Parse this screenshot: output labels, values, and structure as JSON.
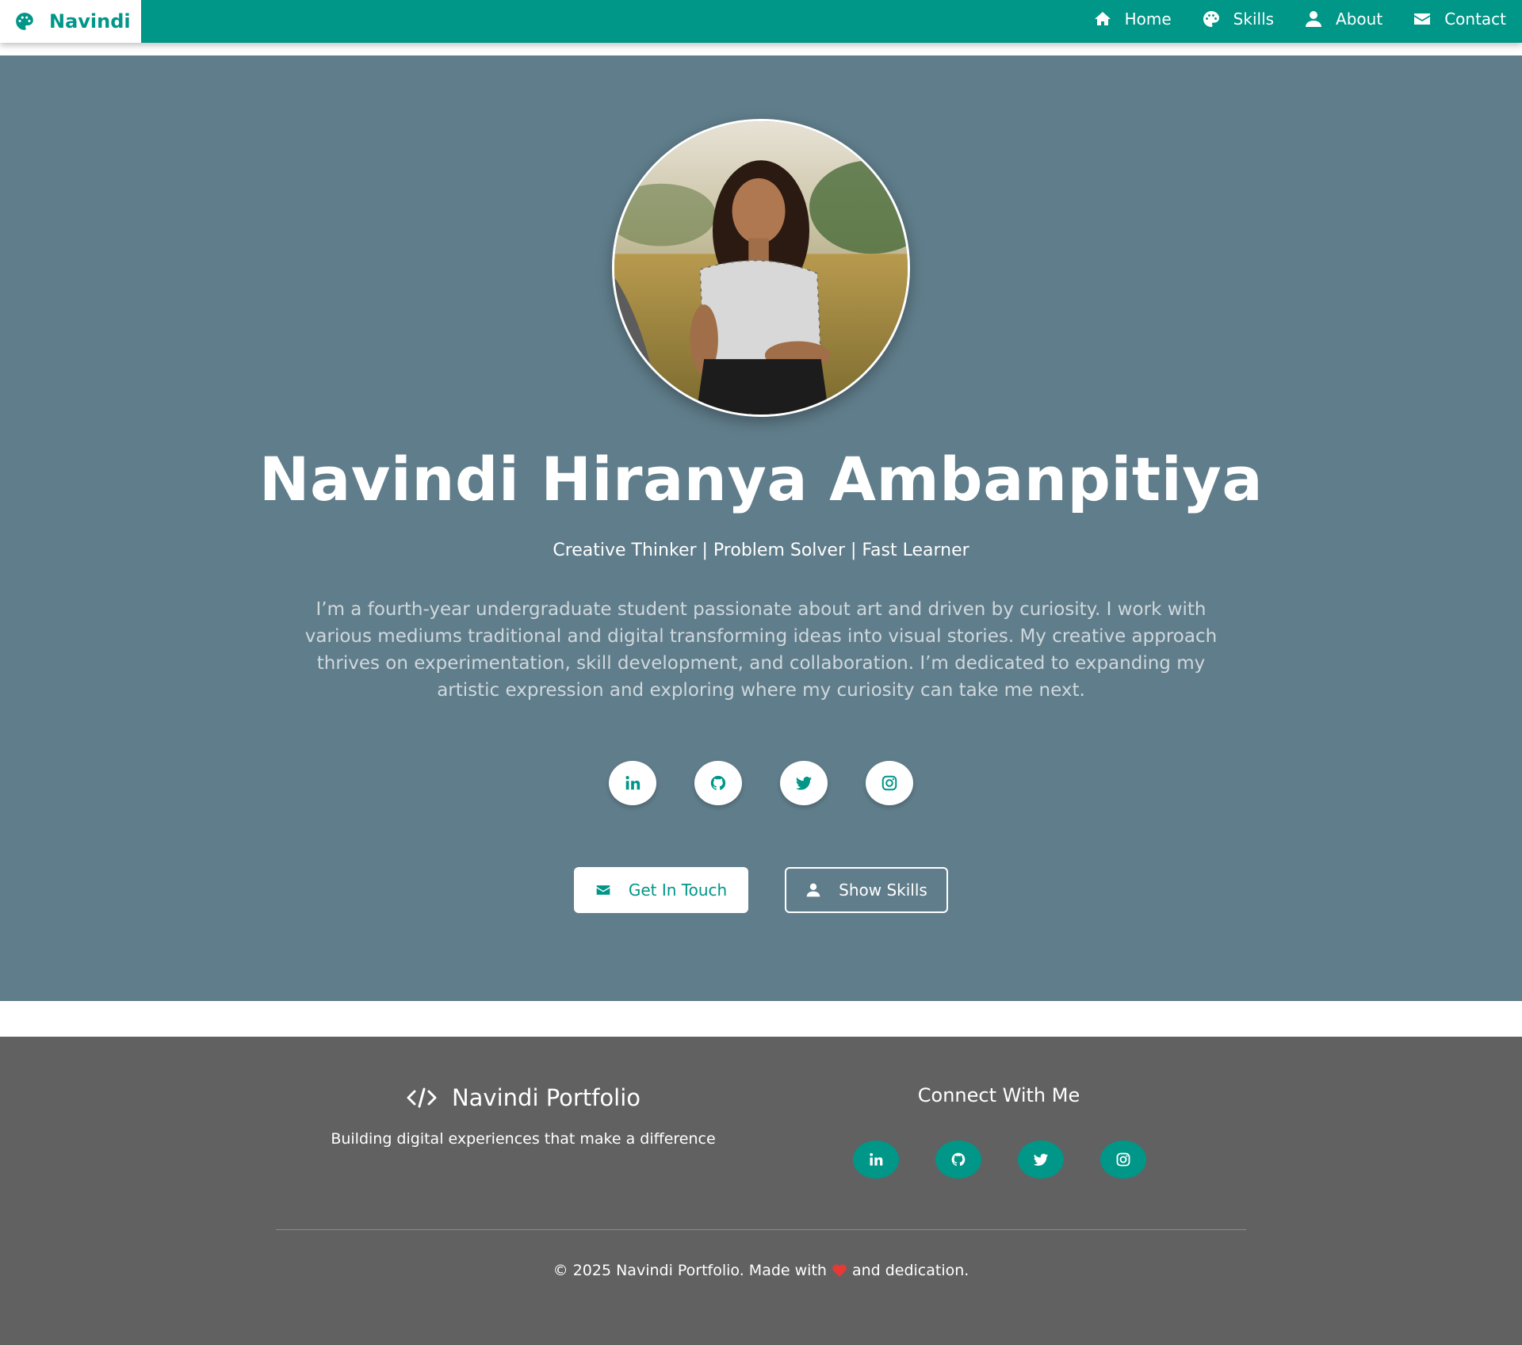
{
  "colors": {
    "accent": "#009688",
    "hero_bg": "#607d8b",
    "footer_bg": "#616161",
    "heart": "#e53935"
  },
  "navbar": {
    "brand": {
      "icon": "palette-icon",
      "label": "Navindi"
    },
    "links": [
      {
        "icon": "home-icon",
        "label": "Home"
      },
      {
        "icon": "palette-icon",
        "label": "Skills"
      },
      {
        "icon": "user-icon",
        "label": "About"
      },
      {
        "icon": "envelope-icon",
        "label": "Contact"
      }
    ]
  },
  "hero": {
    "photo": "profile-photo",
    "name": "Navindi Hiranya Ambanpitiya",
    "tagline": "Creative Thinker | Problem Solver | Fast Learner",
    "bio": "I’m a fourth-year undergraduate student passionate about art and driven by curiosity. I work with various mediums traditional and digital transforming ideas into visual stories. My creative approach thrives on experimentation, skill development, and collaboration. I’m dedicated to expanding my artistic expression and exploring where my curiosity can take me next.",
    "socials": [
      "linkedin-icon",
      "github-icon",
      "twitter-icon",
      "instagram-icon"
    ],
    "buttons": {
      "primary": {
        "icon": "envelope-icon",
        "label": "Get In Touch"
      },
      "secondary": {
        "icon": "user-icon",
        "label": "Show Skills"
      }
    }
  },
  "footer": {
    "brand": {
      "icon": "code-icon",
      "label": "Navindi Portfolio"
    },
    "description": "Building digital experiences that make a difference",
    "connect_title": "Connect With Me",
    "socials": [
      "linkedin-icon",
      "github-icon",
      "twitter-icon",
      "instagram-icon"
    ],
    "copyright_before": "© 2025 Navindi Portfolio. Made with",
    "copyright_after": "and dedication."
  }
}
